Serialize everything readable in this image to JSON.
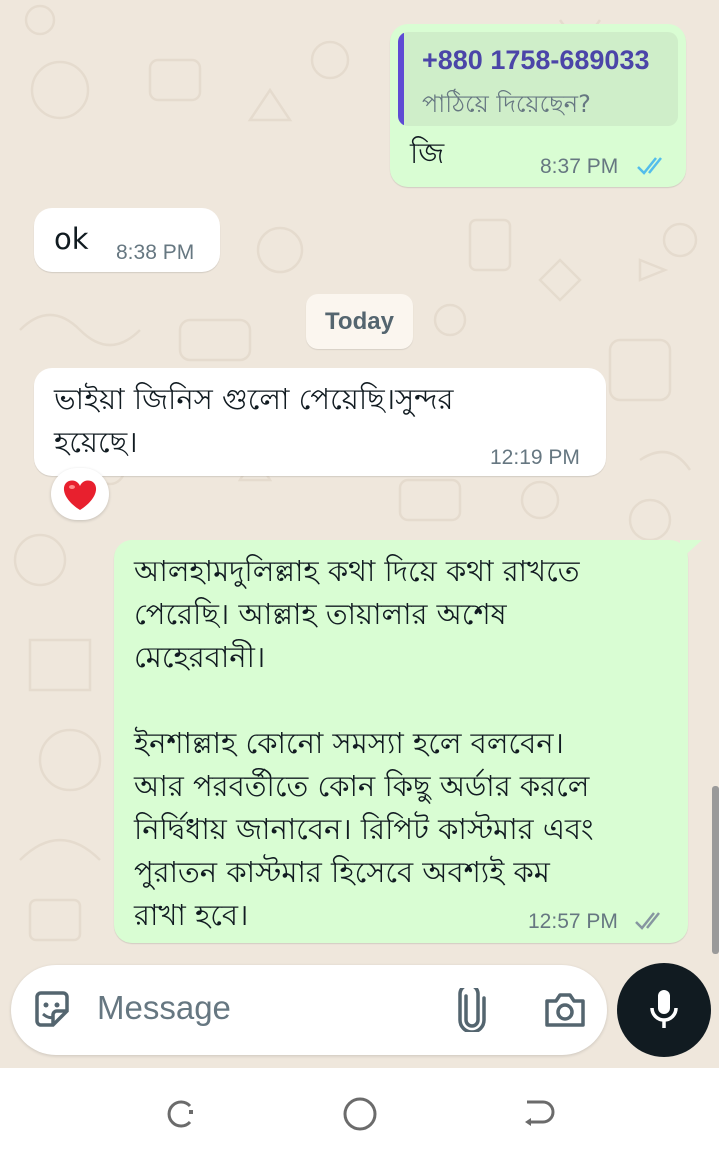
{
  "messages": {
    "reply": {
      "quoted_name": "+880 1758-689033",
      "quoted_text": "পাঠিয়ে দিয়েছেন?",
      "text": "জি",
      "time": "8:37 PM"
    },
    "ok": {
      "text": "ok",
      "time": "8:38 PM"
    },
    "date_divider": "Today",
    "received": {
      "line1": "ভাইয়া জিনিস গুলো পেয়েছি।সুন্দর",
      "line2": "হয়েছে।",
      "time": "12:19 PM",
      "reaction": "❤️"
    },
    "sent": {
      "lines": [
        "আলহামদুলিল্লাহ কথা দিয়ে কথা রাখতে",
        "পেরেছি। আল্লাহ তায়ালার অশেষ",
        "মেহেরবানী।",
        "",
        "ইনশাল্লাহ কোনো সমস্যা হলে বলবেন।",
        "আর পরবর্তীতে কোন কিছু অর্ডার করলে",
        "নির্দ্বিধায় জানাবেন। রিপিট কাস্টমার এবং",
        "পুরাতন কাস্টমার হিসেবে অবশ্যই কম",
        "রাখা হবে।"
      ],
      "time": "12:57 PM"
    }
  },
  "composer": {
    "placeholder": "Message",
    "icons": [
      "sticker-icon",
      "attach-icon",
      "camera-icon",
      "mic-icon"
    ]
  },
  "nav": {
    "icons": [
      "recents-icon",
      "home-icon",
      "back-icon"
    ]
  },
  "colors": {
    "background": "#efe7dc",
    "outgoing": "#d9fdd3",
    "incoming": "#ffffff",
    "read_tick": "#53bdeb",
    "quote_bar": "#5e4bd4",
    "mic_button": "#111b21"
  }
}
